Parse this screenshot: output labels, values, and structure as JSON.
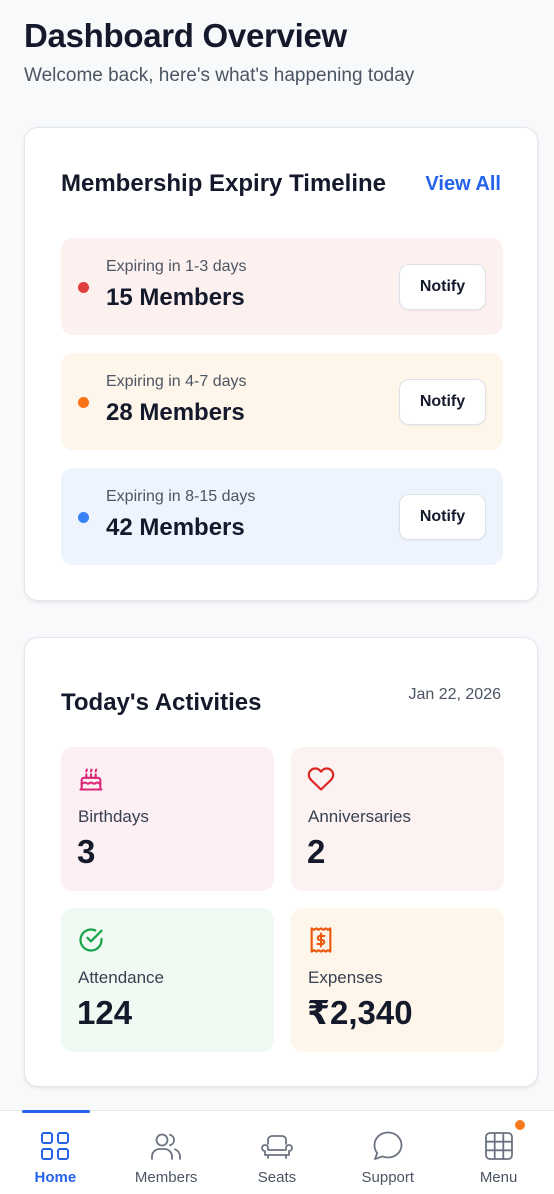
{
  "header": {
    "title": "Dashboard Overview",
    "subtitle": "Welcome back, here's what's happening today"
  },
  "expiry": {
    "title": "Membership Expiry Timeline",
    "view_all": "View All",
    "rows": [
      {
        "range": "Expiring in 1-3 days",
        "count": "15 Members",
        "action": "Notify",
        "dot_color": "#e03e3e"
      },
      {
        "range": "Expiring in 4-7 days",
        "count": "28 Members",
        "action": "Notify",
        "dot_color": "#f97316"
      },
      {
        "range": "Expiring in 8-15 days",
        "count": "42 Members",
        "action": "Notify",
        "dot_color": "#3b82f6"
      }
    ]
  },
  "activities": {
    "title": "Today's Activities",
    "date": "Jan 22, 2026",
    "tiles": [
      {
        "icon": "cake-icon",
        "label": "Birthdays",
        "value": "3",
        "icon_color": "#db2777"
      },
      {
        "icon": "heart-icon",
        "label": "Anniversaries",
        "value": "2",
        "icon_color": "#dc2626"
      },
      {
        "icon": "check-circle-icon",
        "label": "Attendance",
        "value": "124",
        "icon_color": "#16a34a"
      },
      {
        "icon": "receipt-icon",
        "label": "Expenses",
        "value": "₹2,340",
        "icon_color": "#ea580c"
      }
    ]
  },
  "nav": {
    "items": [
      {
        "label": "Home",
        "icon": "home-grid-icon",
        "active": true
      },
      {
        "label": "Members",
        "icon": "users-icon",
        "active": false
      },
      {
        "label": "Seats",
        "icon": "sofa-icon",
        "active": false
      },
      {
        "label": "Support",
        "icon": "chat-bubble-icon",
        "active": false
      },
      {
        "label": "Menu",
        "icon": "grid-menu-icon",
        "active": false,
        "badge_color": "#f57c1f"
      }
    ],
    "accent": "#2563eb"
  }
}
